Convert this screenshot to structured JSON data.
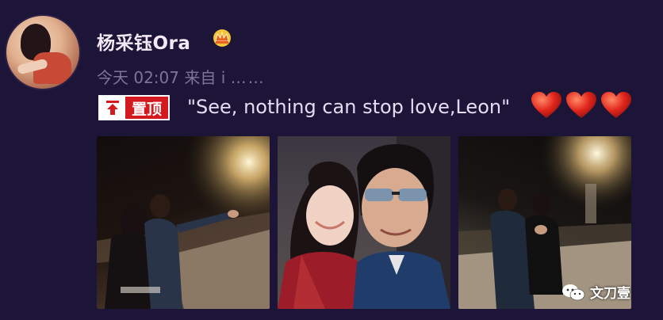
{
  "post": {
    "username": "杨采钰Ora",
    "vip_icon": "crown-badge-icon",
    "meta": {
      "time": "今天 02:07",
      "source": "来自 i"
    },
    "pin_label": "置顶",
    "text": "\"See, nothing can stop love,Leon\"",
    "hearts": [
      "heart-icon",
      "heart-icon",
      "heart-icon"
    ],
    "photos": [
      {
        "icon": "photo-thumbnail"
      },
      {
        "icon": "photo-thumbnail"
      },
      {
        "icon": "photo-thumbnail"
      }
    ],
    "watermark": "文刀壹"
  },
  "colors": {
    "background": "#1d1537",
    "username": "#f3e9f5",
    "meta": "#8e86a8",
    "pin_red": "#d21a1f",
    "text": "#e4dcf2",
    "heart": "#e1261c"
  }
}
